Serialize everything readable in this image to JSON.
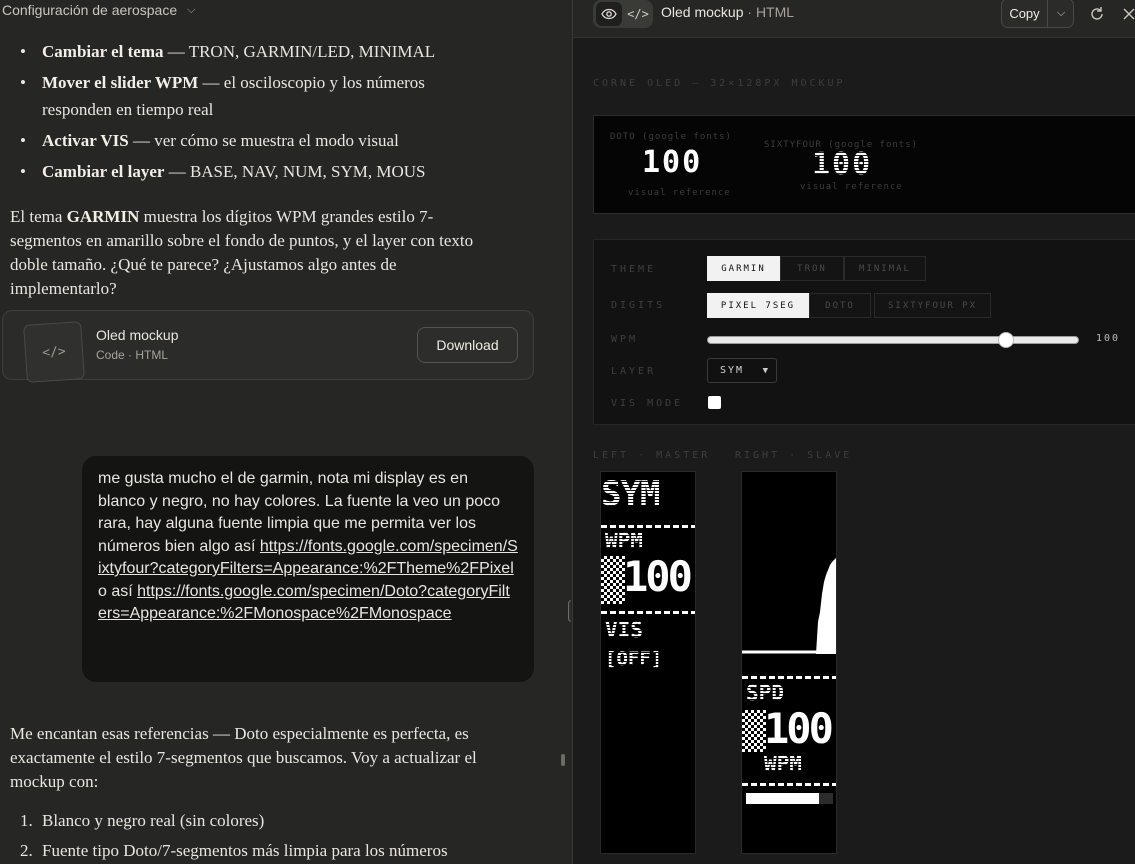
{
  "chat": {
    "header_title": "Configuración de aerospace",
    "bullets": [
      {
        "strong": "Cambiar el tema",
        "rest": " — TRON, GARMIN/LED, MINIMAL"
      },
      {
        "strong": "Mover el slider WPM",
        "rest": " — el osciloscopio y los números responden en tiempo real"
      },
      {
        "strong": "Activar VIS",
        "rest": " — ver cómo se muestra el modo visual"
      },
      {
        "strong": "Cambiar el layer",
        "rest": " — BASE, NAV, NUM, SYM, MOUS"
      }
    ],
    "para1_a": "El tema ",
    "para1_b": "GARMIN",
    "para1_c": " muestra los dígitos WPM grandes estilo 7-segmentos en amarillo sobre el fondo de puntos, y el layer con texto doble tamaño. ¿Qué te parece? ¿Ajustamos algo antes de implementarlo?",
    "artifact": {
      "title": "Oled mockup",
      "subtitle": "Code · HTML",
      "download_label": "Download",
      "thumb_glyph": "</>"
    },
    "user_message": {
      "text": "me gusta mucho el de garmin, nota mi display es en blanco y negro, no hay colores. La fuente la veo un poco rara, hay alguna fuente limpia que me permita ver los números bien algo así",
      "link1": "https://fonts.google.com/specimen/Sixtyfour?categoryFilters=Appearance:%2FTheme%2FPixel",
      "between": " o así",
      "link2": "https://fonts.google.com/specimen/Doto?categoryFilters=Appearance:%2FMonospace%2FMonospace"
    },
    "para2": "Me encantan esas referencias — Doto especialmente es perfecta, es exactamente el estilo 7-segmentos que buscamos. Voy a actualizar el mockup con:",
    "steps": [
      {
        "n": "1.",
        "text": "Blanco y negro real (sin colores)"
      },
      {
        "n": "2.",
        "text": "Fuente tipo Doto/7-segmentos más limpia para los números"
      }
    ]
  },
  "preview": {
    "title": "Oled mockup",
    "title_sep": " · ",
    "title_type": "HTML",
    "copy_label": "Copy",
    "heading": "CORNE OLED — 32×128PX MOCKUP",
    "ref": {
      "doto_label": "DOTO (google fonts)",
      "doto_value": "100",
      "doto_caption": "visual reference",
      "sixty_label": "SIXTYFOUR (google fonts)",
      "sixty_value": "100",
      "sixty_caption": "visual reference"
    },
    "controls": {
      "theme_label": "THEME",
      "theme_options": [
        "GARMIN",
        "TRON",
        "MINIMAL"
      ],
      "theme_selected": "GARMIN",
      "digits_label": "DIGITS",
      "digits_options": [
        "PIXEL 7SEG",
        "DOTO",
        "SIXTYFOUR PX"
      ],
      "digits_selected": "PIXEL 7SEG",
      "wpm_label": "WPM",
      "wpm_value": "100",
      "wpm_fraction": 0.8,
      "layer_label": "LAYER",
      "layer_value": "SYM",
      "vis_label": "VIS MODE",
      "vis_checked": false
    },
    "screens": {
      "left_label": "LEFT · MASTER",
      "right_label": "RIGHT · SLAVE",
      "left": {
        "layer": "SYM",
        "wpm_label": "WPM",
        "wpm": "100",
        "vis_label": "VIS",
        "vis_state": "[OFF]"
      },
      "right": {
        "spd_label": "SPD",
        "spd": "100",
        "unit": "WPM",
        "bar_fraction": 0.84
      }
    }
  }
}
